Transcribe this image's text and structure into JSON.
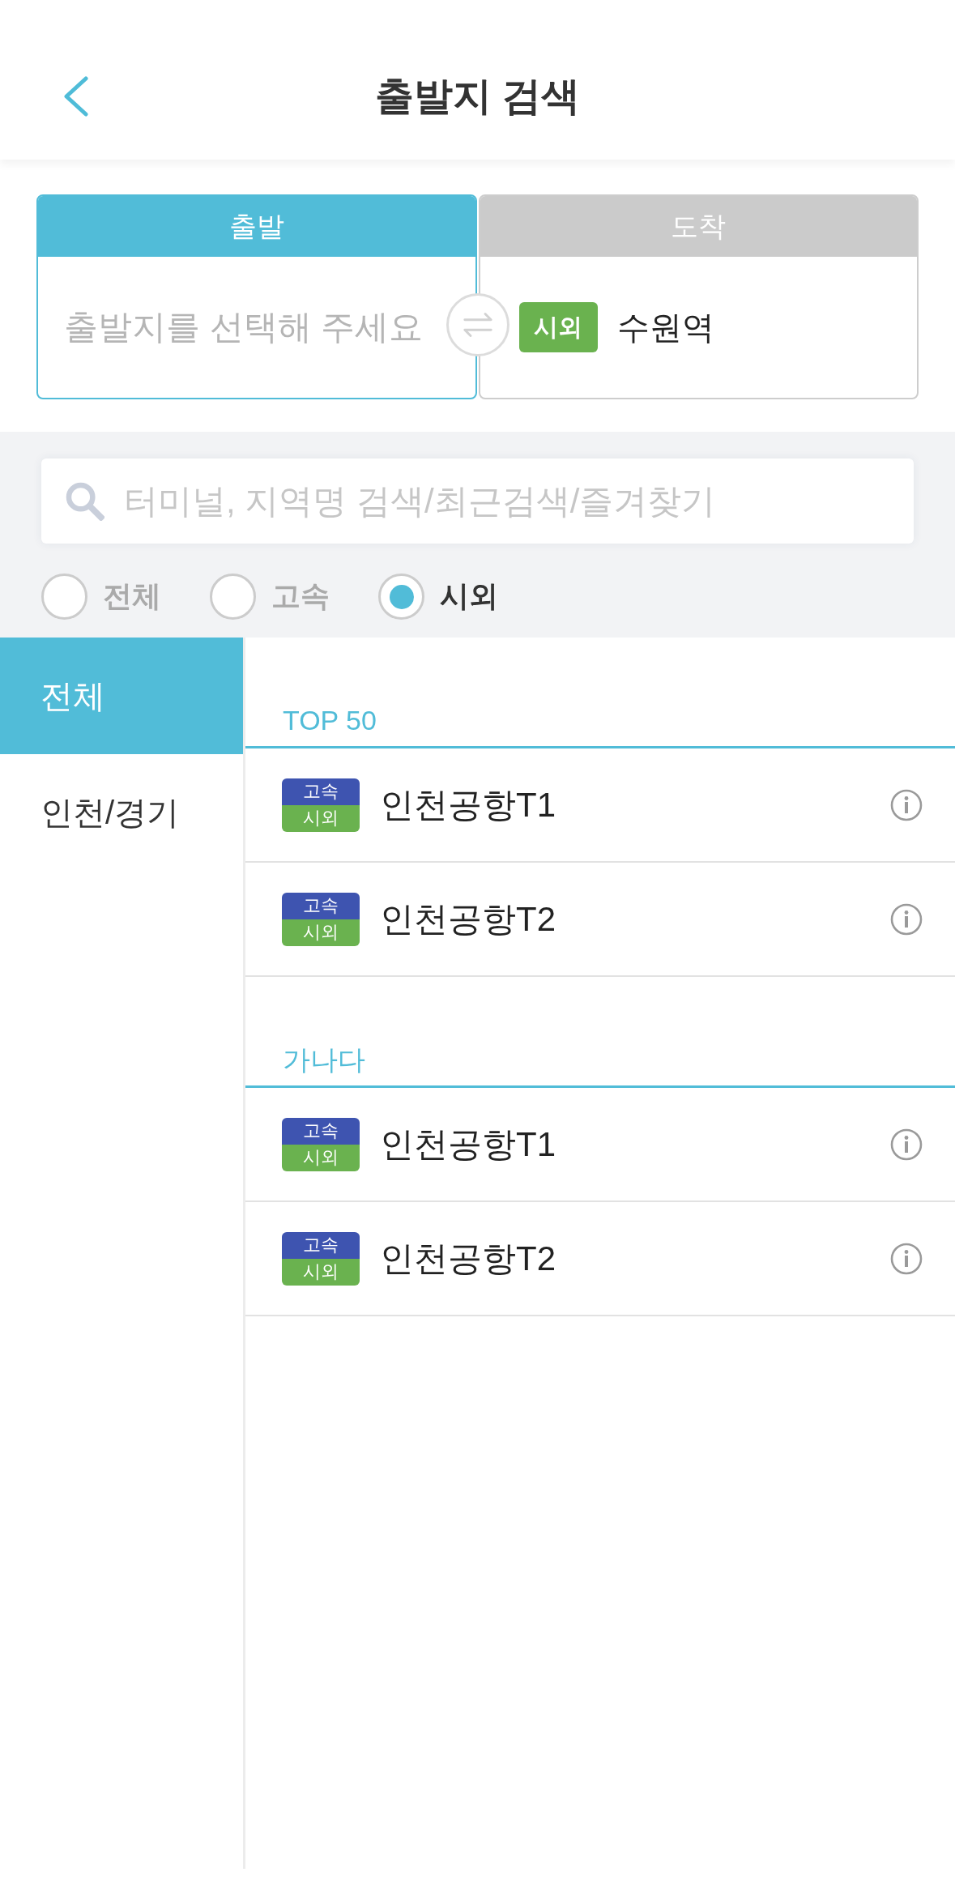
{
  "header": {
    "title": "출발지 검색"
  },
  "route": {
    "segments": [
      {
        "label": "출발",
        "selected": true,
        "placeholder": "출발지를 선택해 주세요"
      },
      {
        "label": "도착",
        "selected": false,
        "value": "수원역",
        "tag": {
          "text": "시외",
          "kind": "intercity"
        }
      }
    ]
  },
  "search": {
    "placeholder": "터미널, 지역명 검색/최근검색/즐겨찾기"
  },
  "filters": [
    {
      "label": "전체",
      "selected": false
    },
    {
      "label": "고속",
      "selected": false
    },
    {
      "label": "시외",
      "selected": true
    }
  ],
  "sidebar": {
    "items": [
      {
        "label": "전체",
        "selected": true
      },
      {
        "label": "인천/경기",
        "selected": false
      }
    ]
  },
  "sections": [
    {
      "title": "TOP 50",
      "items": [
        {
          "name": "인천공항T1",
          "tags": [
            {
              "text": "고속",
              "kind": "express"
            },
            {
              "text": "시외",
              "kind": "intercity"
            }
          ]
        },
        {
          "name": "인천공항T2",
          "tags": [
            {
              "text": "고속",
              "kind": "express"
            },
            {
              "text": "시외",
              "kind": "intercity"
            }
          ]
        }
      ]
    },
    {
      "title": "가나다",
      "items": [
        {
          "name": "인천공항T1",
          "tags": [
            {
              "text": "고속",
              "kind": "express"
            },
            {
              "text": "시외",
              "kind": "intercity"
            }
          ]
        },
        {
          "name": "인천공항T2",
          "tags": [
            {
              "text": "고속",
              "kind": "express"
            },
            {
              "text": "시외",
              "kind": "intercity"
            }
          ]
        }
      ]
    }
  ]
}
